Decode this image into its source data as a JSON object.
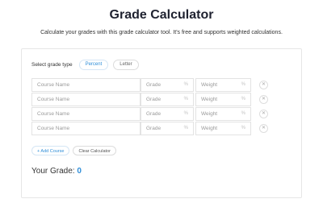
{
  "header": {
    "title": "Grade Calculator",
    "subtitle": "Calculate your grades with this grade calculator tool. It's free and supports weighted calculations."
  },
  "grade_type": {
    "label": "Select grade type",
    "options": [
      "Percent",
      "Letter"
    ],
    "selected": "Percent"
  },
  "rows": [
    {
      "name_placeholder": "Course Name",
      "grade_placeholder": "Grade",
      "weight_placeholder": "Weight",
      "unit": "%"
    },
    {
      "name_placeholder": "Course Name",
      "grade_placeholder": "Grade",
      "weight_placeholder": "Weight",
      "unit": "%"
    },
    {
      "name_placeholder": "Course Name",
      "grade_placeholder": "Grade",
      "weight_placeholder": "Weight",
      "unit": "%"
    },
    {
      "name_placeholder": "Course Name",
      "grade_placeholder": "Grade",
      "weight_placeholder": "Weight",
      "unit": "%"
    }
  ],
  "actions": {
    "add_course": "+ Add Course",
    "clear": "Clear Calculator"
  },
  "result": {
    "label": "Your Grade:",
    "value": "0"
  },
  "colors": {
    "accent": "#2f8ed8",
    "title": "#1f2230",
    "border": "#e3e3e3"
  },
  "icons": {
    "remove": "close-icon",
    "percent": "percent-icon"
  }
}
